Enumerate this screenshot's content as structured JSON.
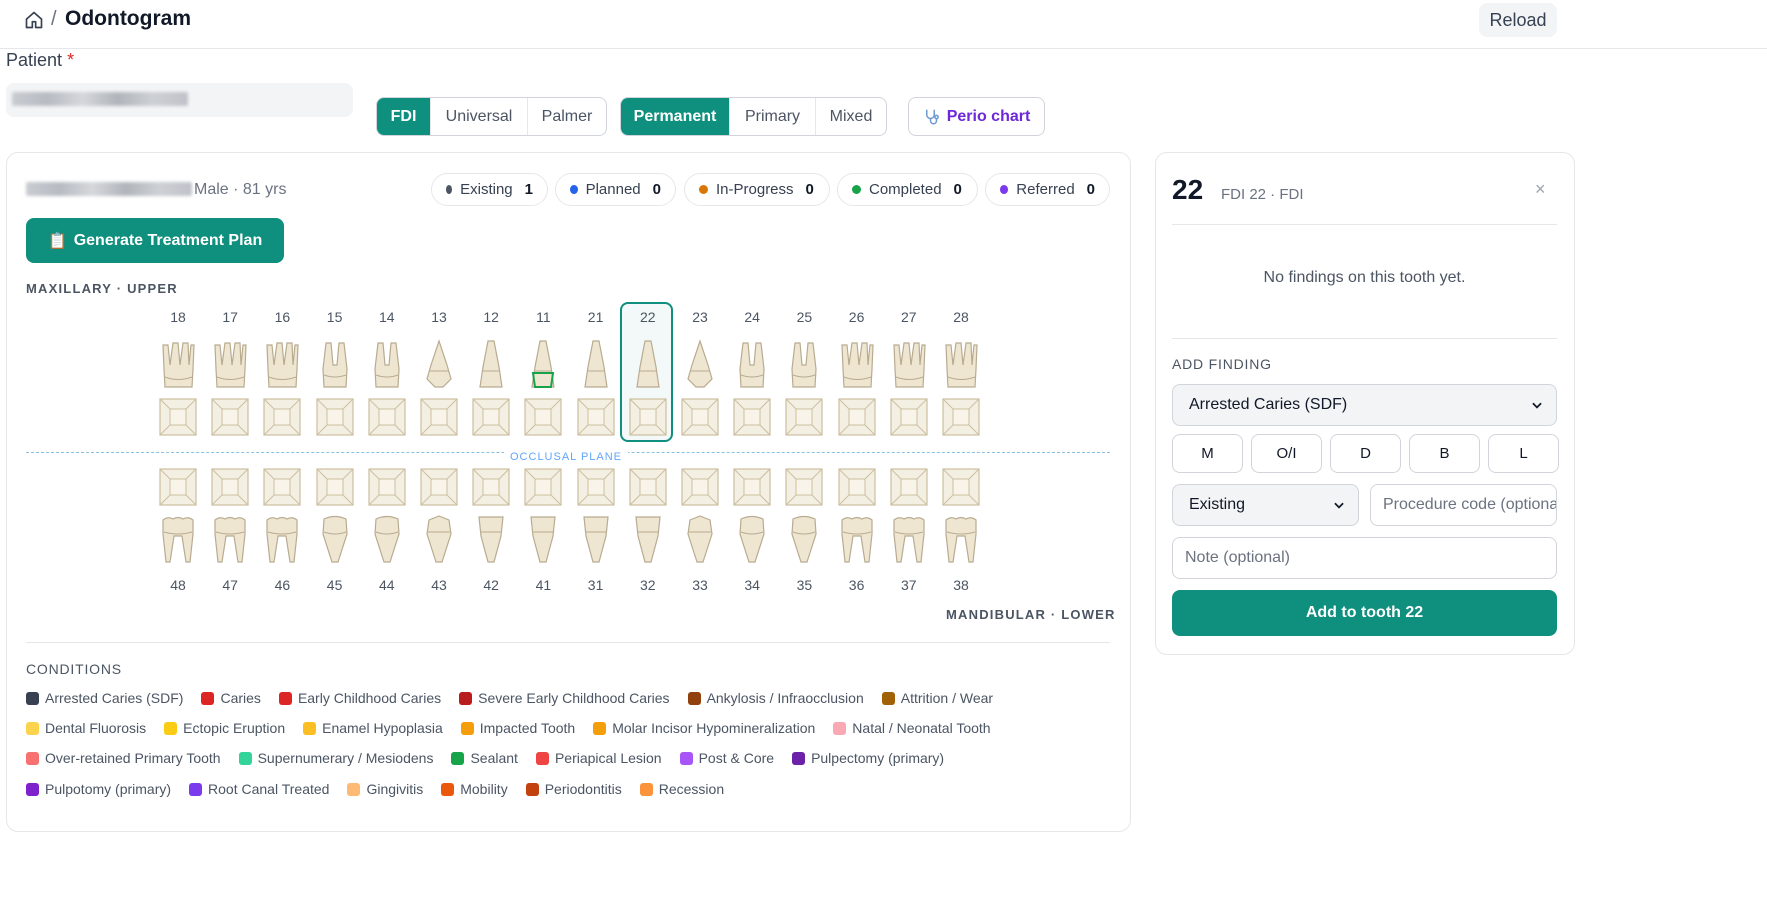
{
  "header": {
    "title": "Odontogram",
    "separator": "/",
    "reload_label": "Reload"
  },
  "patient": {
    "label": "Patient",
    "required_mark": "*"
  },
  "notation": {
    "options": [
      "FDI",
      "Universal",
      "Palmer"
    ],
    "selected": "FDI"
  },
  "dentition": {
    "options": [
      "Permanent",
      "Primary",
      "Mixed"
    ],
    "selected": "Permanent"
  },
  "perio": {
    "label": "Perio chart",
    "icon": "stethoscope-icon"
  },
  "summary": {
    "patient_info": "Male · 81 yrs",
    "statuses": [
      {
        "label": "Existing",
        "count": "1",
        "color": "#4b5563"
      },
      {
        "label": "Planned",
        "count": "0",
        "color": "#2563eb"
      },
      {
        "label": "In-Progress",
        "count": "0",
        "color": "#d97706"
      },
      {
        "label": "Completed",
        "count": "0",
        "color": "#16a34a"
      },
      {
        "label": "Referred",
        "count": "0",
        "color": "#7c3aed"
      }
    ]
  },
  "actions": {
    "generate_plan": "Generate Treatment Plan",
    "generate_icon": "clipboard-icon"
  },
  "chart": {
    "upper_label": "MAXILLARY · UPPER",
    "lower_label": "MANDIBULAR · LOWER",
    "occlusal_label": "OCCLUSAL PLANE",
    "upper_teeth": [
      "18",
      "17",
      "16",
      "15",
      "14",
      "13",
      "12",
      "11",
      "21",
      "22",
      "23",
      "24",
      "25",
      "26",
      "27",
      "28"
    ],
    "lower_teeth": [
      "48",
      "47",
      "46",
      "45",
      "44",
      "43",
      "42",
      "41",
      "31",
      "32",
      "33",
      "34",
      "35",
      "36",
      "37",
      "38"
    ],
    "selected_tooth": "22",
    "marked_tooth": "11",
    "marked_color": "#16a34a"
  },
  "conditions": {
    "title": "CONDITIONS",
    "rows": [
      [
        {
          "label": "Arrested Caries (SDF)",
          "color": "#374151"
        },
        {
          "label": "Caries",
          "color": "#dc2626"
        },
        {
          "label": "Early Childhood Caries",
          "color": "#dc2626"
        },
        {
          "label": "Severe Early Childhood Caries",
          "color": "#b91c1c"
        },
        {
          "label": "Ankylosis / Infraocclusion",
          "color": "#92400e"
        },
        {
          "label": "Attrition / Wear",
          "color": "#a16207"
        }
      ],
      [
        {
          "label": "Dental Fluorosis",
          "color": "#fcd34d"
        },
        {
          "label": "Ectopic Eruption",
          "color": "#facc15"
        },
        {
          "label": "Enamel Hypoplasia",
          "color": "#fbbf24"
        },
        {
          "label": "Impacted Tooth",
          "color": "#f59e0b"
        },
        {
          "label": "Molar Incisor Hypomineralization",
          "color": "#f59e0b"
        },
        {
          "label": "Natal / Neonatal Tooth",
          "color": "#f9a8b4"
        }
      ],
      [
        {
          "label": "Over-retained Primary Tooth",
          "color": "#f87171"
        },
        {
          "label": "Supernumerary / Mesiodens",
          "color": "#34d399"
        },
        {
          "label": "Sealant",
          "color": "#16a34a"
        },
        {
          "label": "Periapical Lesion",
          "color": "#ef4444"
        },
        {
          "label": "Post & Core",
          "color": "#a855f7"
        },
        {
          "label": "Pulpectomy (primary)",
          "color": "#6b21a8"
        }
      ],
      [
        {
          "label": "Pulpotomy (primary)",
          "color": "#7e22ce"
        },
        {
          "label": "Root Canal Treated",
          "color": "#7c3aed"
        },
        {
          "label": "Gingivitis",
          "color": "#fdba74"
        },
        {
          "label": "Mobility",
          "color": "#ea580c"
        },
        {
          "label": "Periodontitis",
          "color": "#c2410c"
        },
        {
          "label": "Recession",
          "color": "#fb923c"
        }
      ]
    ]
  },
  "side_panel": {
    "tooth_number": "22",
    "tooth_subtitle": "FDI 22 · FDI",
    "close_glyph": "×",
    "empty_message": "No findings on this tooth yet.",
    "add_finding_label": "ADD FINDING",
    "finding_select": "Arrested Caries (SDF)",
    "surfaces": [
      "M",
      "O/I",
      "D",
      "B",
      "L"
    ],
    "status_select": "Existing",
    "procedure_placeholder": "Procedure code (optional)",
    "note_placeholder": "Note (optional)",
    "add_button": "Add to tooth 22"
  },
  "colors": {
    "accent": "#0f8f7d",
    "tooth_fill": "#efe6d2",
    "tooth_stroke": "#b8ab90"
  }
}
